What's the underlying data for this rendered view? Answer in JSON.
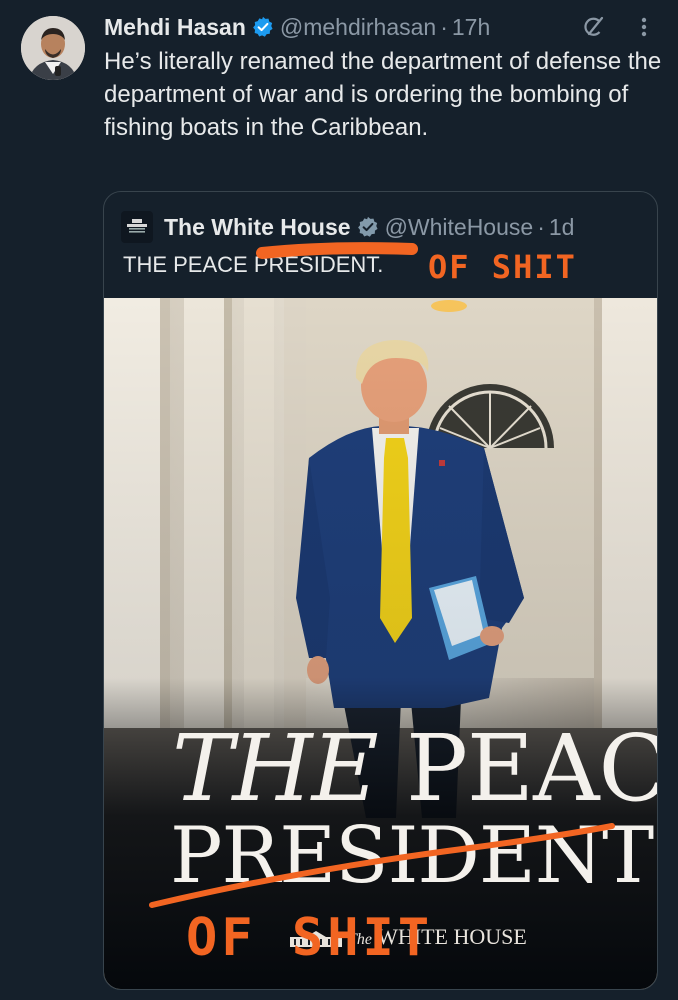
{
  "tweet": {
    "name": "Mehdi Hasan",
    "handle": "@mehdirhasan",
    "time": "17h",
    "text": "He’s literally renamed the department of defense the department of war and is ordering the bombing of fishing boats in the Caribbean."
  },
  "quote": {
    "logo_text": "WHITE HOUSE",
    "name": "The White House",
    "handle": "@WhiteHouse",
    "time": "1d",
    "text_prefix": "THE PEACE ",
    "text_struck": "PRESIDENT",
    "text_suffix": ".",
    "annotation": "OF SHIT",
    "image": {
      "headline_1_italic": "THE",
      "headline_1_rest": "PEACE",
      "headline_2": "PRESIDENT",
      "annotation": "OF SHIT",
      "footer_small": "The",
      "footer": "WHITE HOUSE"
    }
  },
  "colors": {
    "background": "#15202b",
    "verified": "#1d9bf0",
    "secondary_text": "#8b98a5",
    "scribble": "#f26522",
    "tie": "#f2d21a"
  },
  "icons": {
    "verified": "verified-badge-icon",
    "grok": "grok-icon",
    "more": "more-vertical-icon"
  }
}
